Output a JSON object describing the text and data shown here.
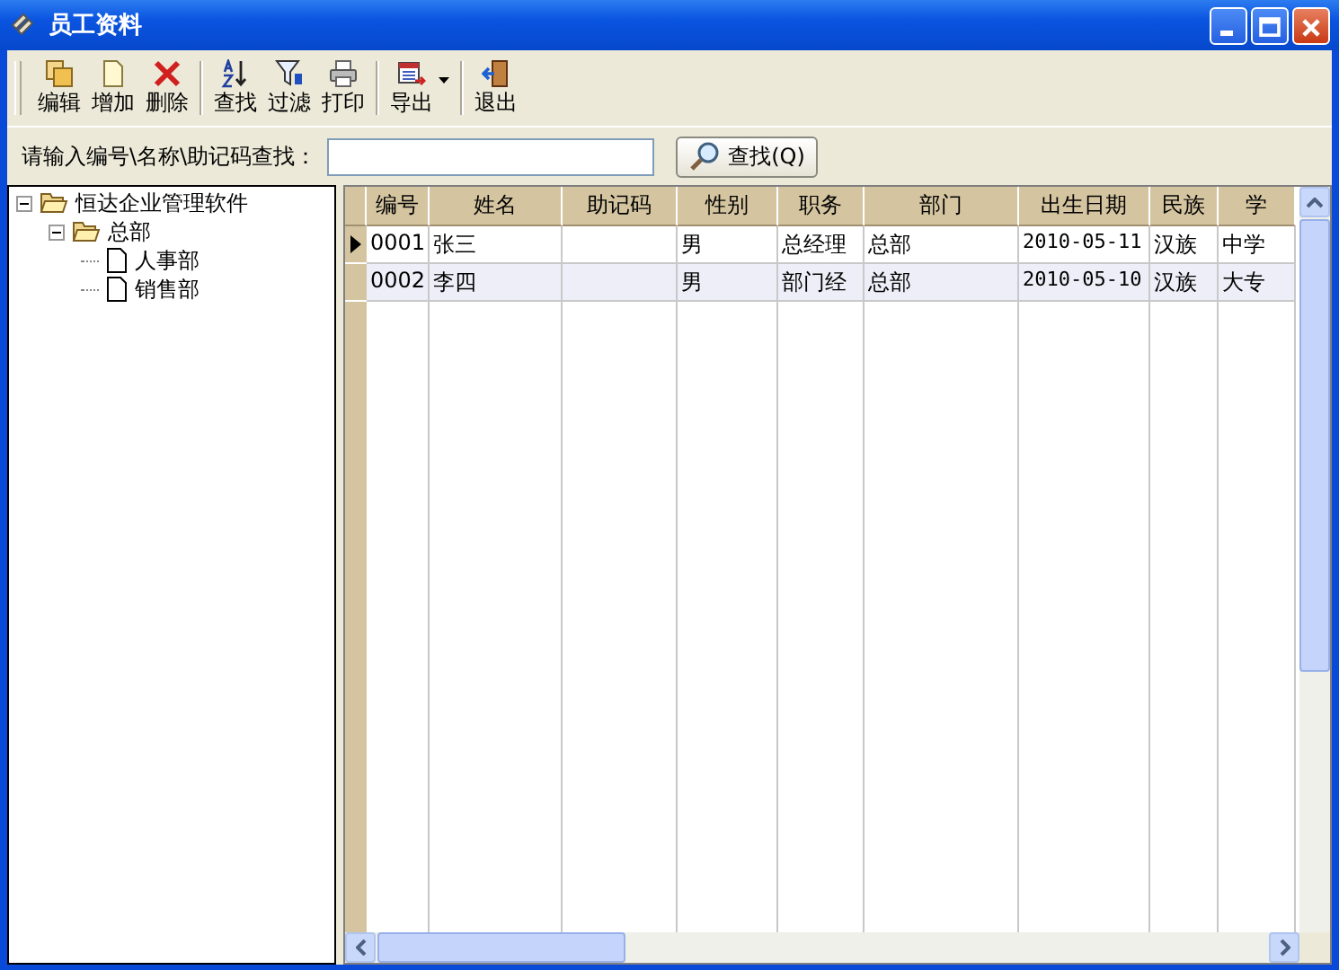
{
  "window": {
    "title": "员工资料"
  },
  "toolbar": [
    {
      "kind": "edit",
      "label": "编辑"
    },
    {
      "kind": "add",
      "label": "增加"
    },
    {
      "kind": "delete",
      "label": "删除"
    },
    {
      "kind": "separator"
    },
    {
      "kind": "sort",
      "label": "查找"
    },
    {
      "kind": "filter",
      "label": "过滤"
    },
    {
      "kind": "print",
      "label": "打印"
    },
    {
      "kind": "separator"
    },
    {
      "kind": "export",
      "label": "导出",
      "has_menu": true
    },
    {
      "kind": "separator"
    },
    {
      "kind": "exit",
      "label": "退出"
    }
  ],
  "search": {
    "label": "请输入编号\\名称\\助记码查找：",
    "button": "查找(Q)"
  },
  "tree": [
    {
      "label": "恒达企业管理软件",
      "expanded": true,
      "children": [
        {
          "label": "总部",
          "expanded": true,
          "children": [
            {
              "label": "人事部"
            },
            {
              "label": "销售部"
            }
          ]
        }
      ]
    }
  ],
  "table": {
    "columns": [
      "编号",
      "姓名",
      "助记码",
      "性别",
      "职务",
      "部门",
      "出生日期",
      "民族",
      "学"
    ],
    "rows": [
      {
        "selected": true,
        "cells": [
          "0001",
          "张三",
          "",
          "男",
          "总经理",
          "总部",
          "2010-05-11",
          "汉族",
          "中学"
        ]
      },
      {
        "selected": false,
        "cells": [
          "0002",
          "李四",
          "",
          "男",
          "部门经",
          "总部",
          "2010-05-10",
          "汉族",
          "大专"
        ]
      }
    ]
  }
}
